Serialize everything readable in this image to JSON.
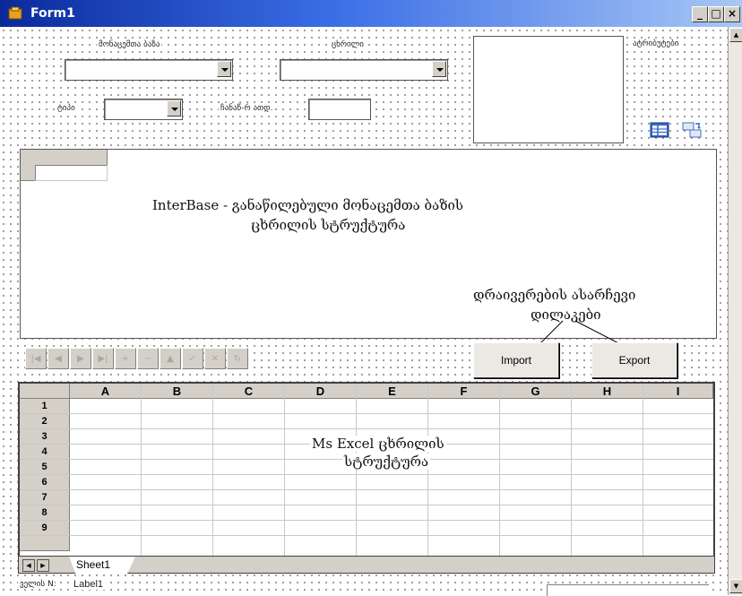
{
  "window": {
    "title": "Form1",
    "minimize": "_",
    "restore": "□",
    "close": "×"
  },
  "top": {
    "db_label": "მონაცემთა ბაზა",
    "table_label": "ცხრილი",
    "attributes_label": "ატრიბუტები",
    "type_label": "ტიპი",
    "records_label": "ჩანაწ-რ ათდ."
  },
  "annotations": {
    "interbase_line1": "InterBase - განაწილებული მონაცემთა ბაზის",
    "interbase_line2": "ცხრილის სტრუქტურა",
    "driver_line1": "დრაივერების ასარჩევი",
    "driver_line2": "დილაკები",
    "excel_line1": "Ms Excel ცხრილის",
    "excel_line2": "სტრუქტურა"
  },
  "buttons": {
    "import": "Import",
    "export": "Export"
  },
  "navigator": [
    "|◀",
    "◀",
    "▶",
    "▶|",
    "+",
    "−",
    "▲",
    "✓",
    "✕",
    "↻"
  ],
  "sheet": {
    "columns": [
      "A",
      "B",
      "C",
      "D",
      "E",
      "F",
      "G",
      "H",
      "I"
    ],
    "rows": [
      "1",
      "2",
      "3",
      "4",
      "5",
      "6",
      "7",
      "8",
      "9"
    ],
    "tab": "Sheet1"
  },
  "status": {
    "label": "ველის N:",
    "value": "Label1"
  }
}
